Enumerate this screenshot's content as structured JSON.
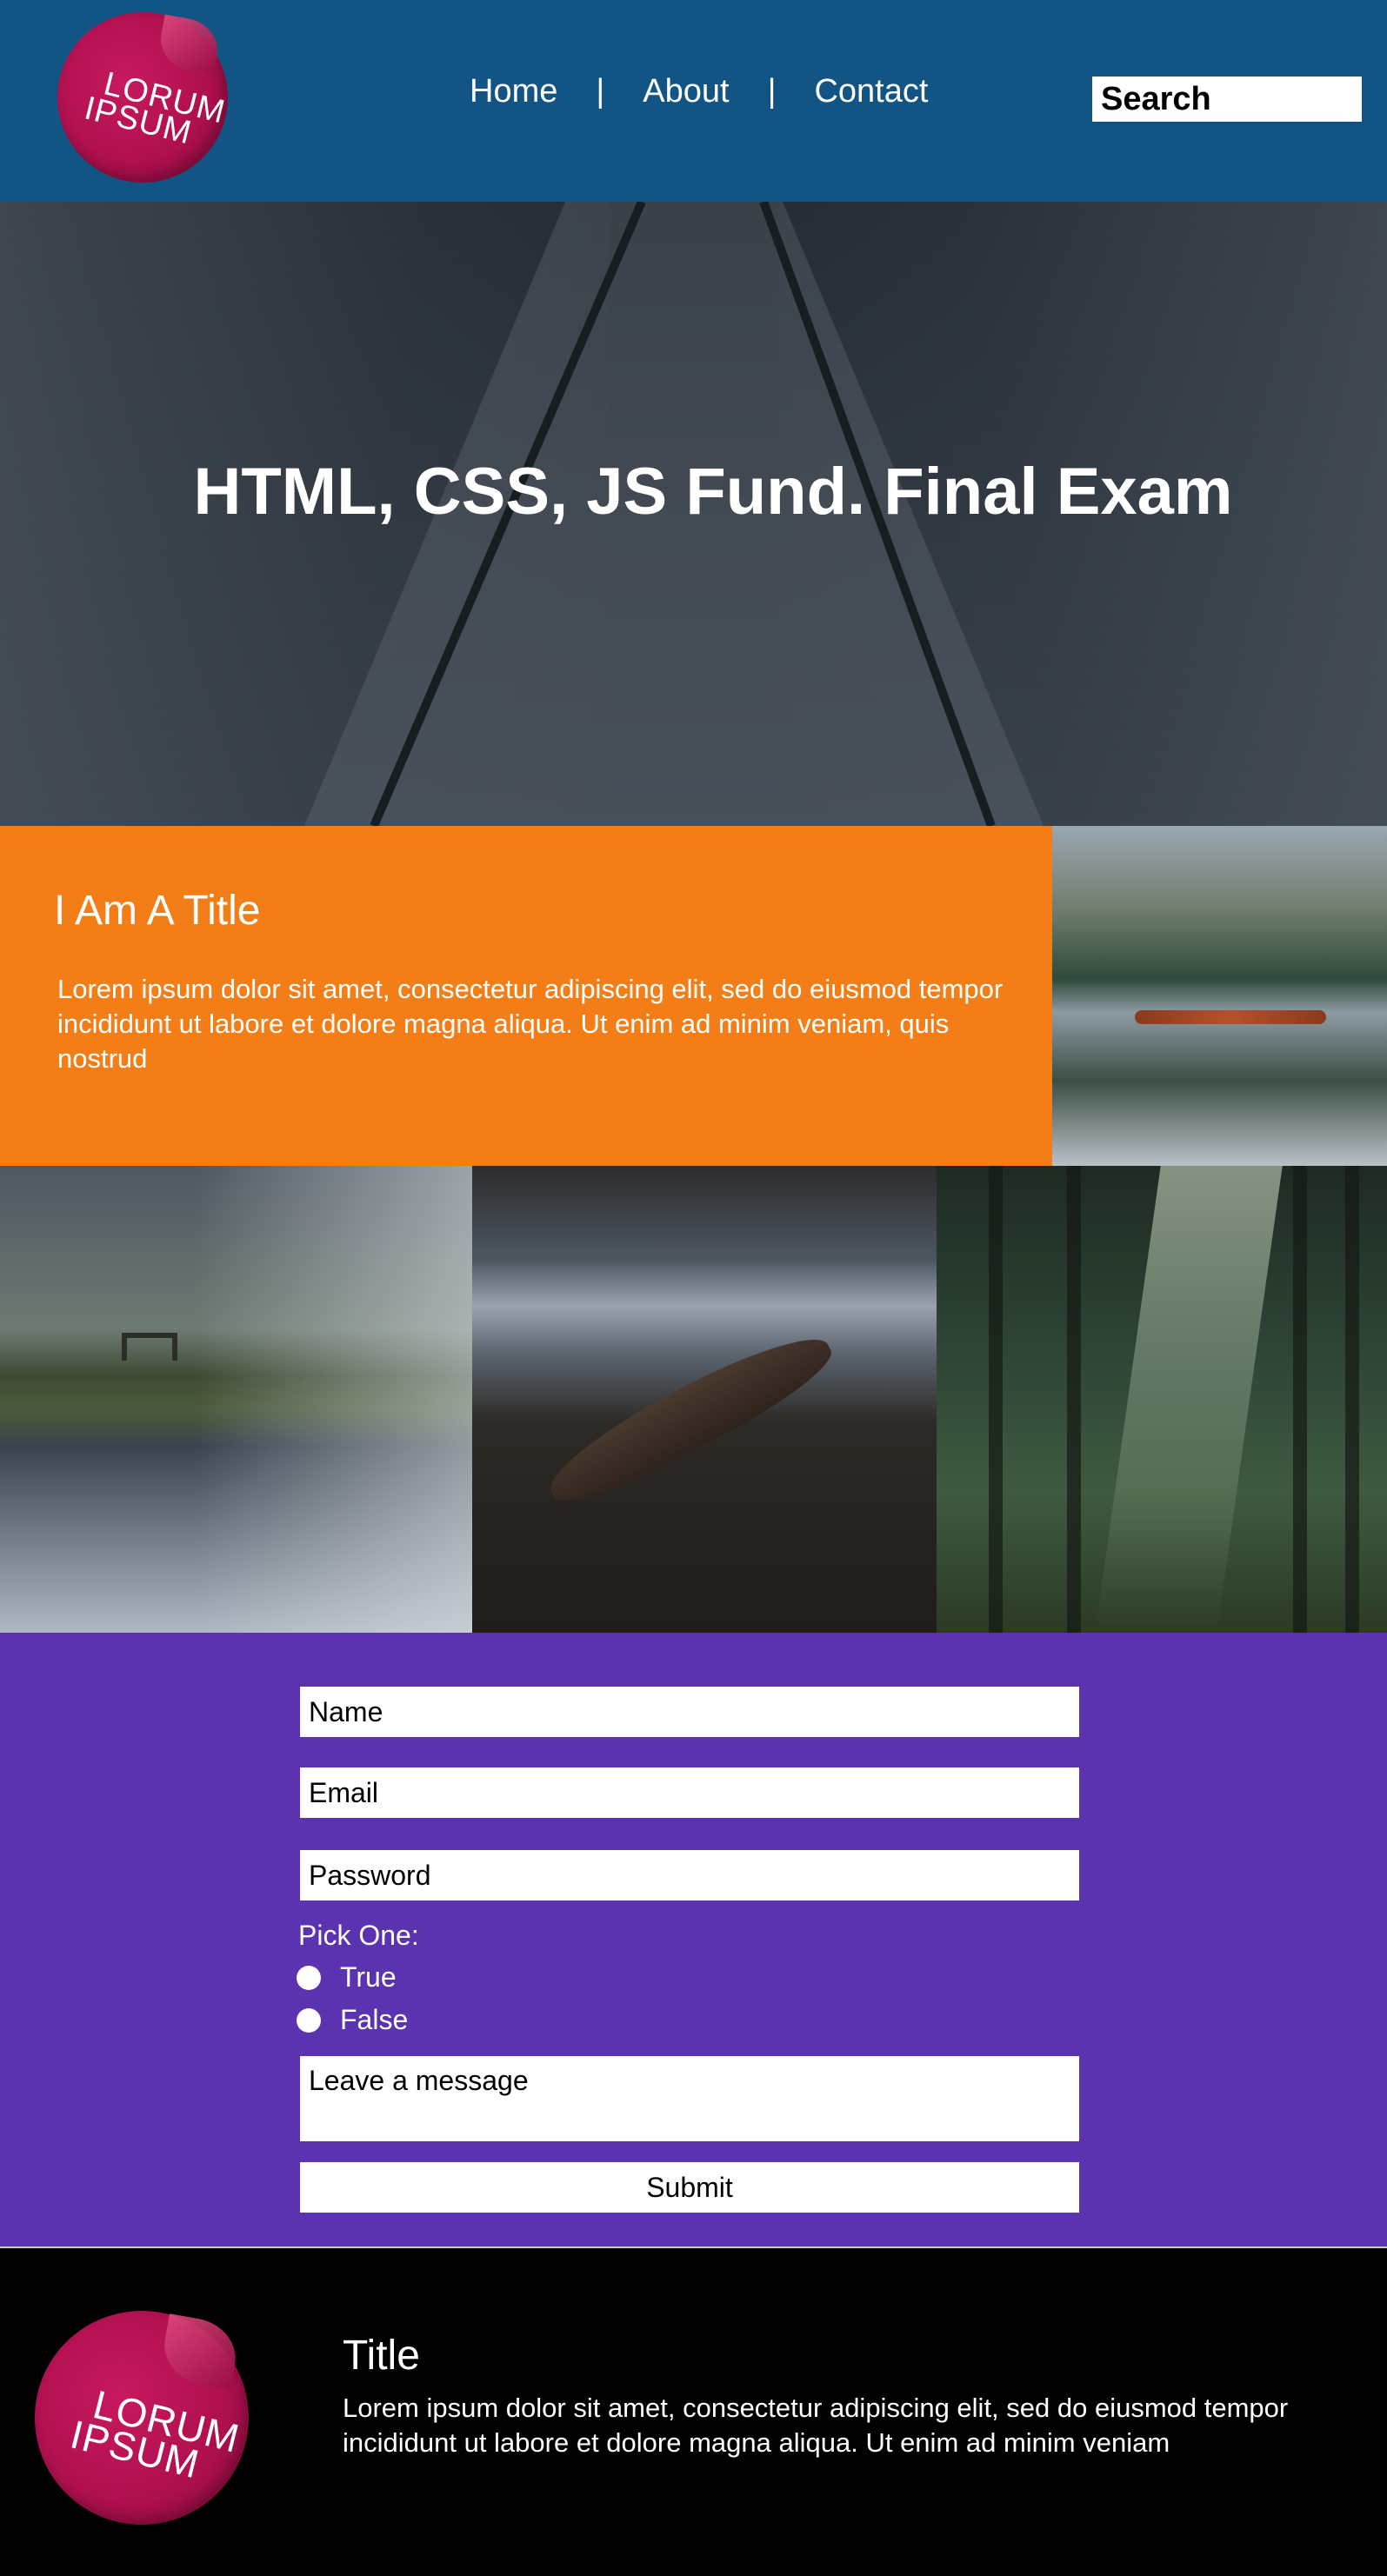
{
  "header": {
    "logo": {
      "line1": "LORUM",
      "line2": "IPSUM"
    },
    "nav": [
      {
        "label": "Home"
      },
      {
        "label": "About"
      },
      {
        "label": "Contact"
      }
    ],
    "separator": "|",
    "search_placeholder": "Search"
  },
  "hero": {
    "title": "HTML, CSS, JS Fund. Final Exam"
  },
  "feature": {
    "title": "I Am A Title",
    "text": "Lorem ipsum dolor sit amet, consectetur adipiscing elit, sed do eiusmod tempor incididunt ut labore et dolore magna aliqua. Ut enim ad minim veniam, quis nostrud"
  },
  "gallery": [
    {
      "icon": "lake-mountain-photo"
    },
    {
      "icon": "foggy-park-reflection-photo"
    },
    {
      "icon": "rowboat-lake-photo"
    },
    {
      "icon": "forest-sunlight-photo"
    }
  ],
  "form": {
    "name_placeholder": "Name",
    "email_placeholder": "Email",
    "password_placeholder": "Password",
    "pick_label": "Pick One:",
    "options": [
      {
        "label": "True"
      },
      {
        "label": "False"
      }
    ],
    "message_placeholder": "Leave a message",
    "submit_label": "Submit"
  },
  "footer": {
    "logo": {
      "line1": "LORUM",
      "line2": "IPSUM"
    },
    "title": "Title",
    "text": "Lorem ipsum dolor sit amet, consectetur adipiscing elit, sed do eiusmod tempor incididunt ut labore et dolore magna aliqua. Ut enim ad minim veniam"
  },
  "colors": {
    "header_bg": "#125584",
    "orange_bg": "#f37e17",
    "form_bg": "#5b33b0",
    "footer_bg": "#000000",
    "logo_pink": "#b0104f"
  }
}
